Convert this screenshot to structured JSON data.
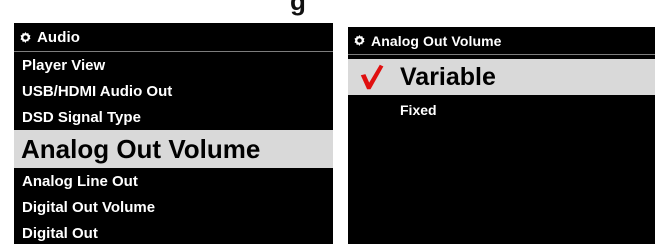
{
  "left_panel": {
    "header": "Audio",
    "items": [
      {
        "label": "Player View"
      },
      {
        "label": "USB/HDMI Audio Out"
      },
      {
        "label": "DSD Signal Type"
      },
      {
        "label": "Analog Out Volume",
        "selected": true
      },
      {
        "label": "Analog Line Out"
      },
      {
        "label": "Digital Out Volume"
      },
      {
        "label": "Digital Out"
      }
    ]
  },
  "right_panel": {
    "header": "Analog Out Volume",
    "options": [
      {
        "label": "Variable",
        "selected": true
      },
      {
        "label": "Fixed"
      }
    ]
  },
  "icons": {
    "header_icon": "gear-icon",
    "selected_icon": "checkmark-icon"
  },
  "colors": {
    "background": "#000000",
    "text": "#ffffff",
    "highlight": "#d9d9d9",
    "checkmark": "#e01010"
  }
}
